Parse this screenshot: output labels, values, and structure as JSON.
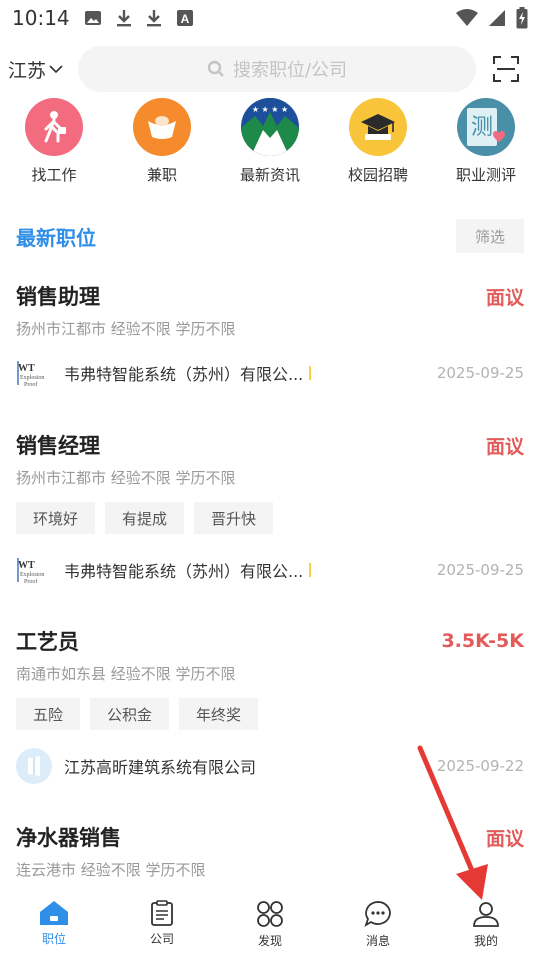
{
  "status_bar": {
    "time": "10:14",
    "left_icons": [
      "image-icon",
      "download-icon",
      "download-icon",
      "text-a-icon"
    ],
    "right_icons": [
      "wifi-icon",
      "signal-icon",
      "battery-charging-icon"
    ]
  },
  "header": {
    "city": "江苏",
    "search_placeholder": "搜索职位/公司",
    "scan_icon": "scan-icon"
  },
  "categories": [
    {
      "label": "找工作",
      "icon": "walking-person-icon",
      "color": "#f36b7f"
    },
    {
      "label": "兼职",
      "icon": "ingot-icon",
      "color": "#f58b2c"
    },
    {
      "label": "最新资讯",
      "icon": "mountain-emblem-icon",
      "color": "#1d8a4a"
    },
    {
      "label": "校园招聘",
      "icon": "graduation-cap-icon",
      "color": "#f7c43a"
    },
    {
      "label": "职业测评",
      "icon": "test-heart-icon",
      "color": "#4a8fa8"
    }
  ],
  "section": {
    "title": "最新职位",
    "filter_label": "筛选"
  },
  "jobs": [
    {
      "title": "销售助理",
      "salary": "面议",
      "meta": "扬州市江都市 经验不限 学历不限",
      "tags": [],
      "company": "韦弗特智能系统（苏州）有限公...",
      "date": "2025-09-25"
    },
    {
      "title": "销售经理",
      "salary": "面议",
      "meta": "扬州市江都市 经验不限 学历不限",
      "tags": [
        "环境好",
        "有提成",
        "晋升快"
      ],
      "company": "韦弗特智能系统（苏州）有限公...",
      "date": "2025-09-25"
    },
    {
      "title": "工艺员",
      "salary": "3.5K-5K",
      "meta": "南通市如东县 经验不限 学历不限",
      "tags": [
        "五险",
        "公积金",
        "年终奖"
      ],
      "company": "江苏高昕建筑系统有限公司",
      "date": "2025-09-22"
    },
    {
      "title": "净水器销售",
      "salary": "面议",
      "meta": "连云港市 经验不限 学历不限",
      "tags": [],
      "company": "",
      "date": ""
    }
  ],
  "bottom_nav": [
    {
      "label": "职位",
      "icon": "home-icon",
      "active": true
    },
    {
      "label": "公司",
      "icon": "clipboard-icon",
      "active": false
    },
    {
      "label": "发现",
      "icon": "grid-circles-icon",
      "active": false
    },
    {
      "label": "消息",
      "icon": "chat-bubble-icon",
      "active": false
    },
    {
      "label": "我的",
      "icon": "person-icon",
      "active": false
    }
  ],
  "colors": {
    "accent": "#2f8fe8",
    "salary": "#e35a5a",
    "arrow": "#e53935"
  }
}
